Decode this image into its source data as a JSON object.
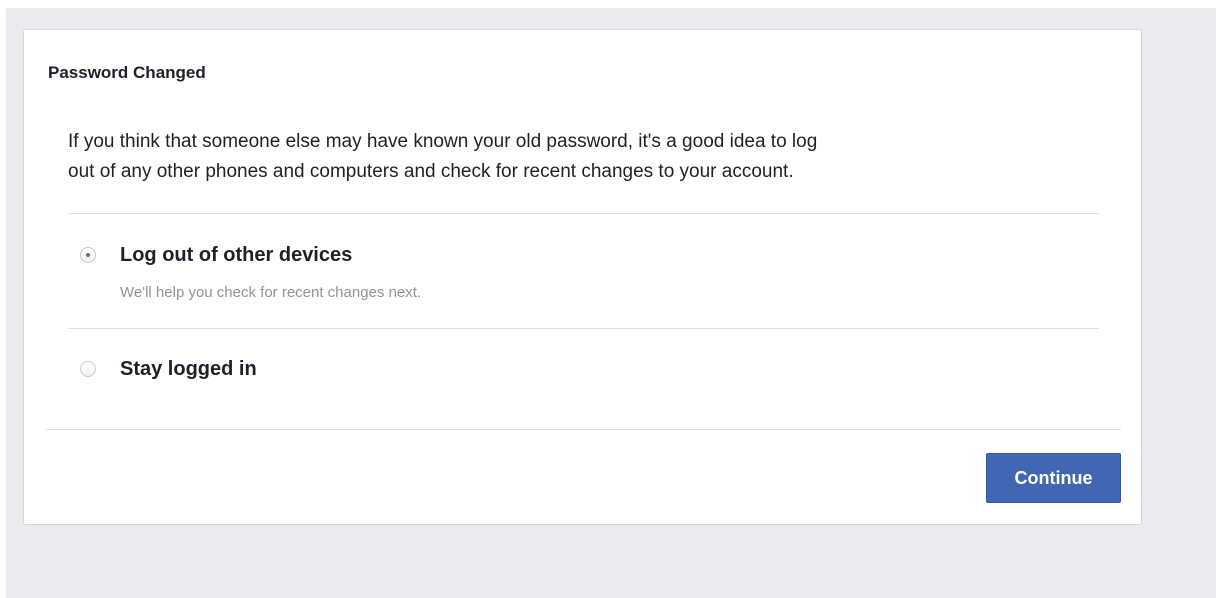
{
  "dialog": {
    "title": "Password Changed",
    "intro_line1": "If you think that someone else may have known your old password, it's a good idea to log",
    "intro_line2": "out of any other phones and computers and check for recent changes to your account."
  },
  "options": [
    {
      "label": "Log out of other devices",
      "description": "We'll help you check for recent changes next.",
      "selected": true
    },
    {
      "label": "Stay logged in",
      "selected": false
    }
  ],
  "actions": {
    "continue_label": "Continue"
  },
  "colors": {
    "page_background": "#e9ebee",
    "primary_button": "#4267b2",
    "text": "#1d2129",
    "secondary_text": "#90949c"
  },
  "icons": {
    "selected_option": "radio-checked-icon",
    "unselected_option": "radio-unchecked-icon"
  }
}
